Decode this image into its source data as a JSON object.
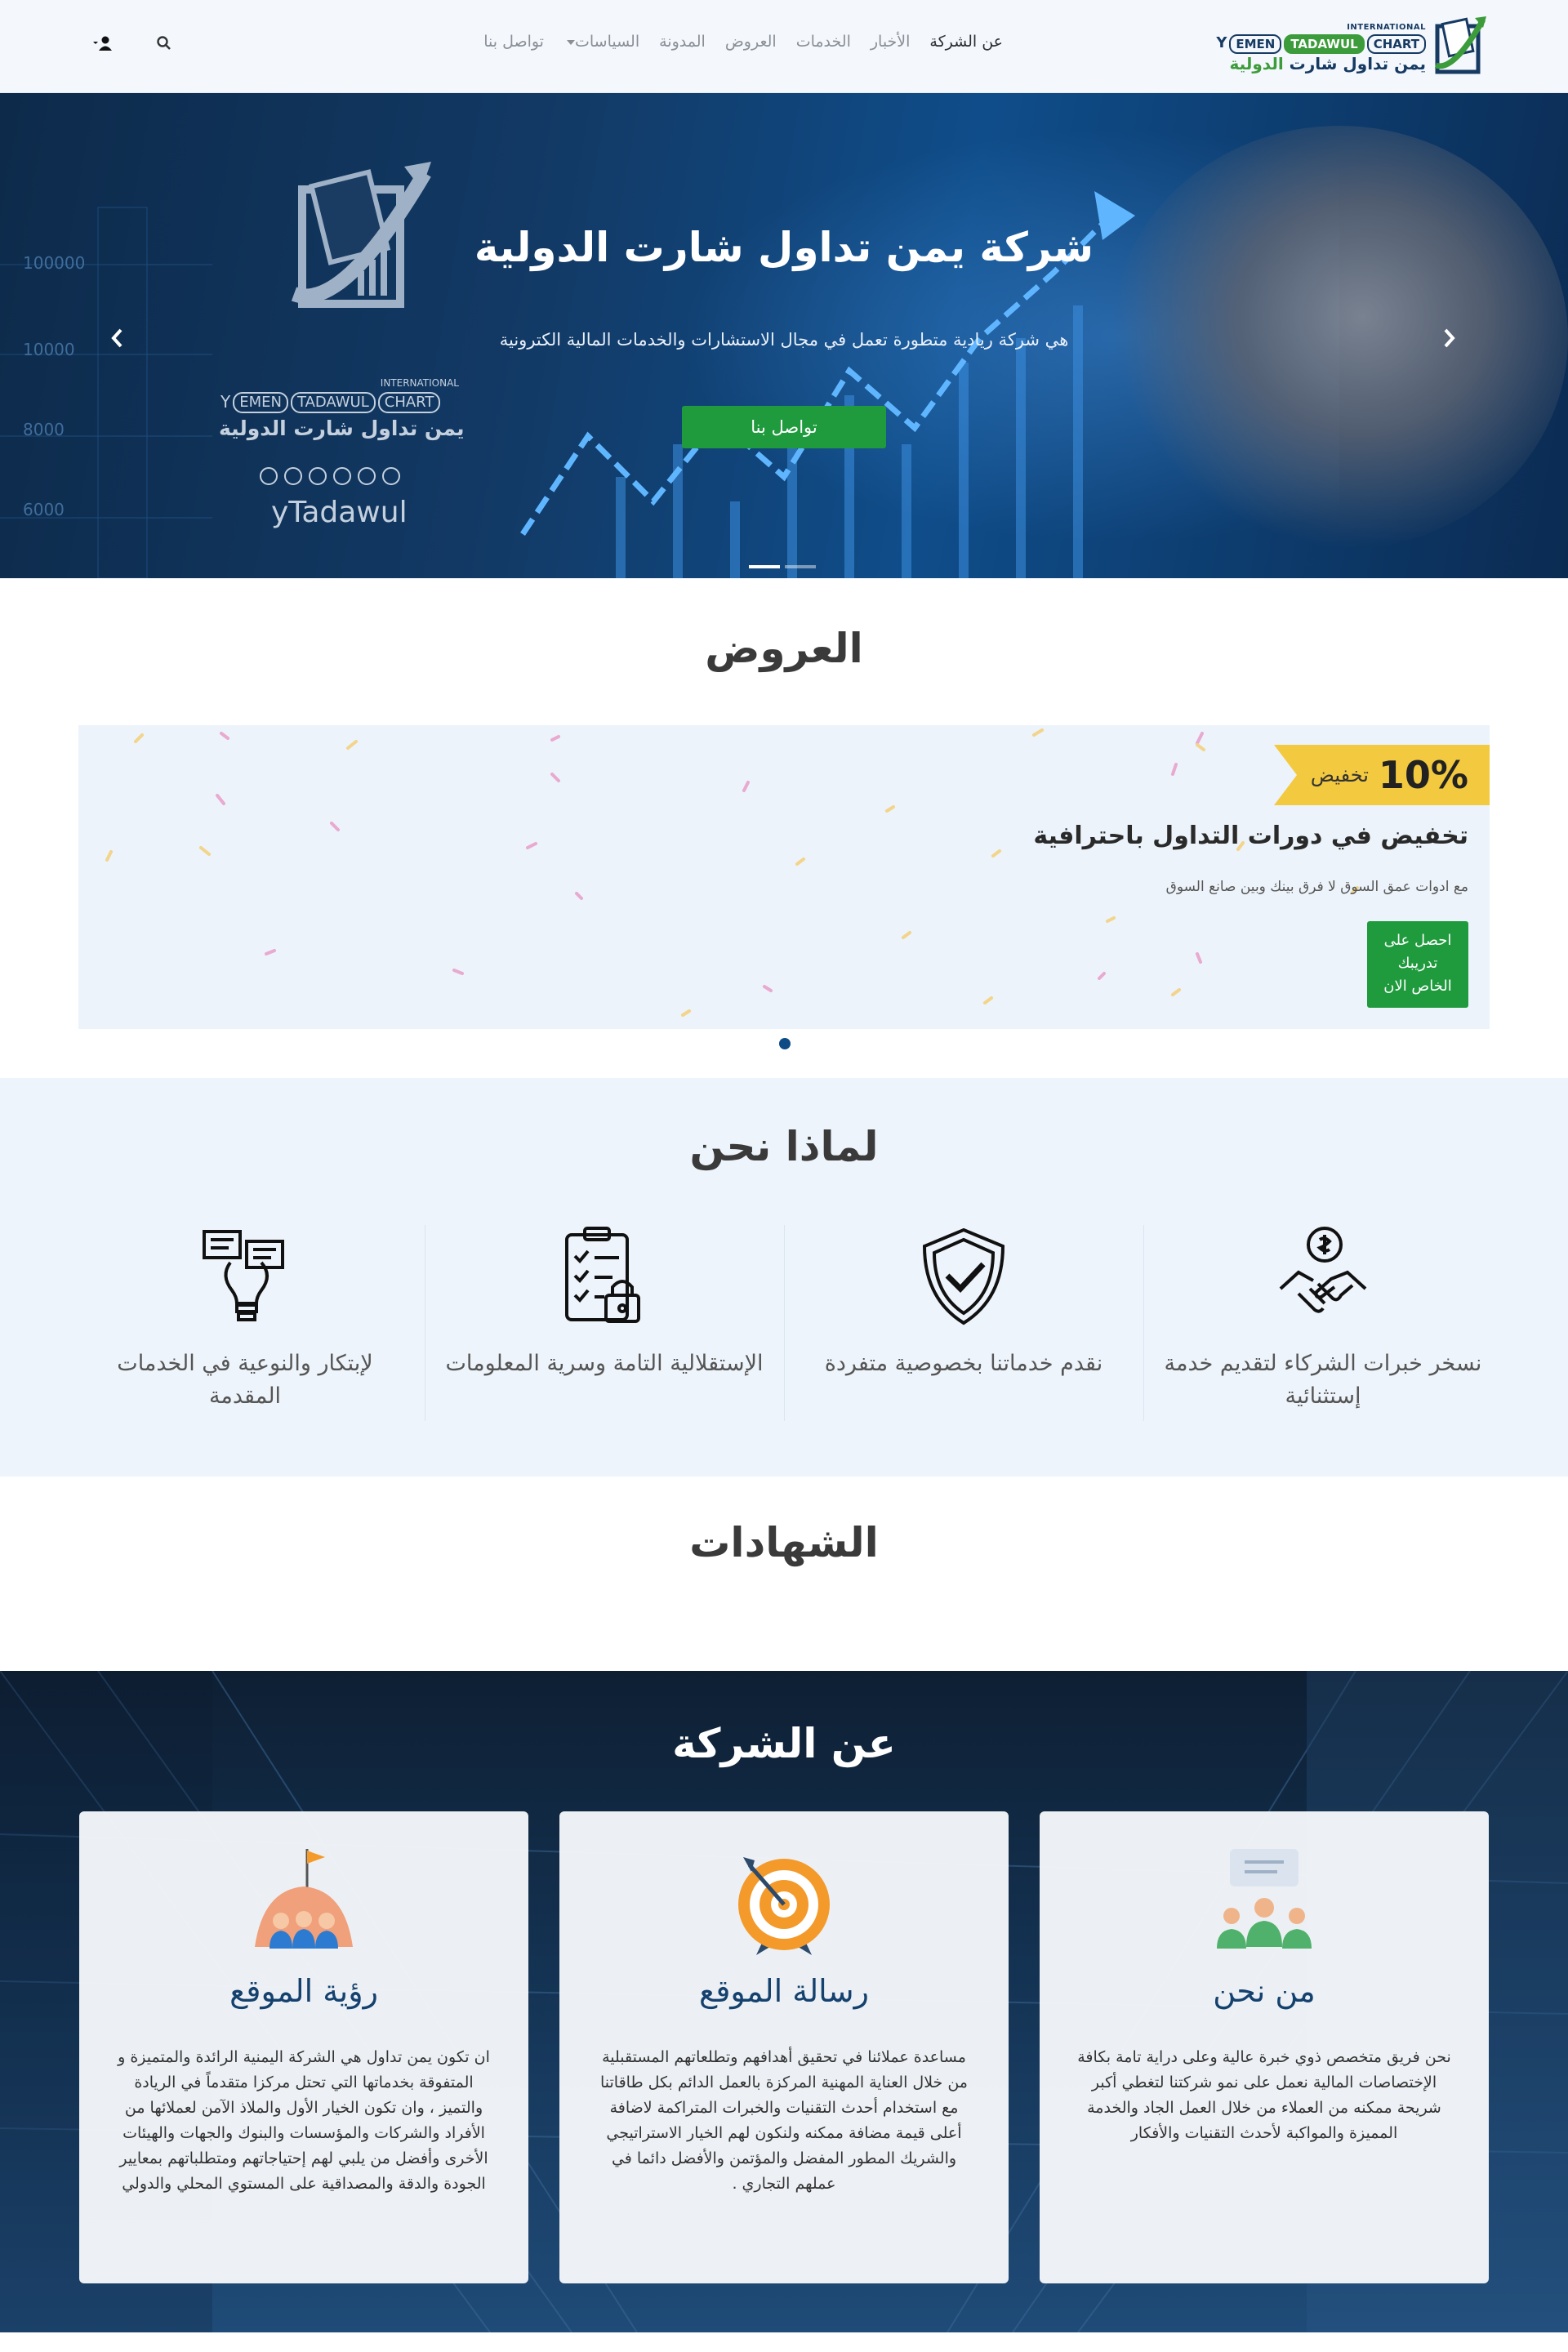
{
  "brand": {
    "intl": "INTERNATIONAL",
    "en_parts": [
      "EMEN",
      "TADAWUL",
      "CHART"
    ],
    "en_prefix": "Y",
    "ar_main": "يمن تداول شارت",
    "ar_suffix": "الدولية"
  },
  "nav": {
    "items": [
      {
        "label": "عن الشركة",
        "active": true
      },
      {
        "label": "الأخبار"
      },
      {
        "label": "الخدمات"
      },
      {
        "label": "العروض"
      },
      {
        "label": "المدونة"
      },
      {
        "label": "السياسات",
        "dropdown": true
      },
      {
        "label": "تواصل بنا"
      }
    ],
    "icons": [
      "search-icon",
      "user-icon"
    ]
  },
  "hero": {
    "title": "شركة يمن تداول شارت الدولية",
    "subtitle": "هي شركة ريادية متطورة تعمل في مجال الاستشارات والخدمات المالية الكترونية",
    "button": "تواصل بنا",
    "axis_labels": [
      "100000",
      "10000",
      "8000",
      "6000"
    ],
    "logo": {
      "intl": "INTERNATIONAL",
      "en_prefix": "Y",
      "en_parts": [
        "EMEN",
        "TADAWUL",
        "CHART"
      ],
      "ar": "يمن تداول شارت الدولية",
      "handle": "yTadawul"
    },
    "slides": 2,
    "active_slide": 2
  },
  "offers": {
    "title": "العروض",
    "card": {
      "discount": "10%",
      "discount_label": "تخفيض",
      "heading": "تخفيض في دورات التداول باحترافية",
      "text": "مع ادوات عمق السوق لا فرق بينك وبين صانع السوق",
      "button_lines": [
        "احصل على",
        "تدريبك",
        "الخاص الان"
      ]
    }
  },
  "why": {
    "title": "لماذا نحن",
    "items": [
      {
        "text": "نسخر خبرات الشركاء لتقديم خدمة إستثنائية",
        "icon": "handshake-dollar-icon"
      },
      {
        "text": "نقدم خدماتنا بخصوصية متفردة",
        "icon": "shield-check-icon"
      },
      {
        "text": "الإستقلالية التامة وسرية المعلومات",
        "icon": "clipboard-lock-icon"
      },
      {
        "text": "لإبتكار والنوعية في الخدمات المقدمة",
        "icon": "lightbulb-ideas-icon"
      }
    ]
  },
  "testimonials": {
    "title": "الشهادات"
  },
  "about": {
    "title": "عن الشركة",
    "cards": [
      {
        "title": "من نحن",
        "icon": "team-icon",
        "text": "نحن فريق متخصص ذوي خبرة عالية وعلى دراية تامة بكافة الإختصاصات المالية نعمل على نمو شركتنا لتغطي أكبر شريحة ممكنه من العملاء من خلال العمل الجاد والخدمة المميزة والمواكبة لأحدث التقنيات والأفكار"
      },
      {
        "title": "رسالة الموقع",
        "icon": "target-icon",
        "text": "مساعدة عملائنا في تحقيق أهدافهم وتطلعاتهم المستقبلية من خلال العناية المهنية المركزة بالعمل الدائم بكل طاقاتنا مع استخدام أحدث التقنيات والخبرات المتراكمة لاضافة أعلى قيمة مضافة ممكنه ولنكون لهم الخيار الاستراتيجي والشريك المطور المفضل والمؤتمن والأفضل دائما في عملهم التجاري ."
      },
      {
        "title": "رؤية الموقع",
        "icon": "vision-flag-icon",
        "text": "ان تكون يمن تداول هي الشركة اليمنية الرائدة والمتميزة و المتفوقة بخدماتها التي تحتل مركزا متقدماً في الريادة والتميز ، وان تكون الخيار الأول والملاذ الآمن لعملائها من الأفراد والشركات والمؤسسات والبنوك والجهات والهيئات الأخرى وأفضل من يلبي لهم إحتياجاتهم ومتطلباتهم بمعايير الجودة والدقة والمصداقية على المستوي المحلي والدولي"
      }
    ]
  }
}
